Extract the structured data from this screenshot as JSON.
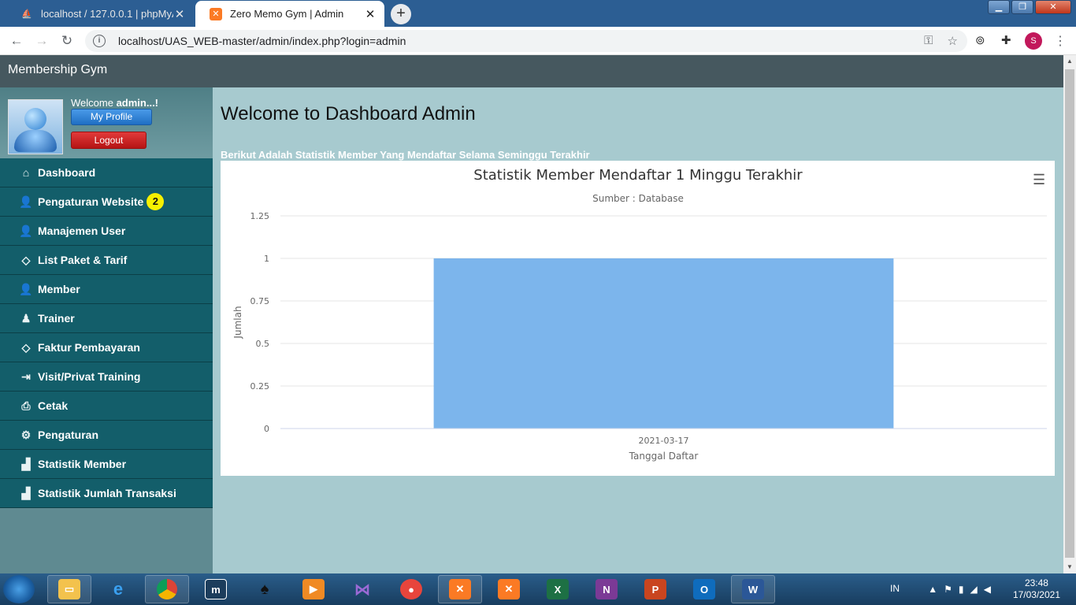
{
  "browser": {
    "tabs": [
      {
        "label": "localhost / 127.0.0.1 | phpMyAdmin",
        "active": false
      },
      {
        "label": "Zero Memo Gym | Admin",
        "active": true
      }
    ],
    "url": "localhost/UAS_WEB-master/admin/index.php?login=admin",
    "profile_initial": "S",
    "minimize": "▁",
    "maximize": "❐",
    "close": "✕"
  },
  "page": {
    "brand": "Membership Gym",
    "welcome_prefix": "Welcome ",
    "welcome_user": "admin...!",
    "my_profile_label": "My Profile",
    "logout_label": "Logout",
    "title": "Welcome to Dashboard Admin",
    "subtitle": "Berikut Adalah Statistik Member Yang Mendaftar Selama Seminggu Terakhir"
  },
  "sidebar": {
    "items": [
      {
        "label": "Dashboard",
        "icon": "home-icon"
      },
      {
        "label": "Pengaturan Website",
        "icon": "user-icon",
        "badge": "2"
      },
      {
        "label": "Manajemen User",
        "icon": "user-icon"
      },
      {
        "label": "List Paket & Tarif",
        "icon": "tag-icon"
      },
      {
        "label": "Member",
        "icon": "user-icon"
      },
      {
        "label": "Trainer",
        "icon": "trainer-icon"
      },
      {
        "label": "Faktur Pembayaran",
        "icon": "tag-icon"
      },
      {
        "label": "Visit/Privat Training",
        "icon": "sign-in-icon"
      },
      {
        "label": "Cetak",
        "icon": "print-icon"
      },
      {
        "label": "Pengaturan",
        "icon": "gear-icon"
      },
      {
        "label": "Statistik Member",
        "icon": "bar-chart-icon"
      },
      {
        "label": "Statistik Jumlah Transaksi",
        "icon": "bar-chart-icon"
      }
    ]
  },
  "chart_data": {
    "type": "bar",
    "title": "Statistik Member Mendaftar 1 Minggu Terakhir",
    "subtitle": "Sumber : Database",
    "categories": [
      "2021-03-17"
    ],
    "values": [
      1
    ],
    "xlabel": "Tanggal Daftar",
    "ylabel": "Jumlah",
    "ylim": [
      0,
      1.25
    ],
    "yticks": [
      "0",
      "0.25",
      "0.5",
      "0.75",
      "1",
      "1.25"
    ],
    "grid": true,
    "bar_color": "#7cb5ec"
  },
  "taskbar": {
    "apps": [
      {
        "name": "explorer"
      },
      {
        "name": "ie"
      },
      {
        "name": "chrome"
      },
      {
        "name": "m"
      },
      {
        "name": "inkscape"
      },
      {
        "name": "media"
      },
      {
        "name": "vs"
      },
      {
        "name": "camera"
      },
      {
        "name": "xampp"
      },
      {
        "name": "xampp2"
      },
      {
        "name": "excel"
      },
      {
        "name": "onenote"
      },
      {
        "name": "powerpoint"
      },
      {
        "name": "outlook"
      },
      {
        "name": "word"
      }
    ],
    "lang": "IN",
    "time": "23:48",
    "date": "17/03/2021"
  }
}
